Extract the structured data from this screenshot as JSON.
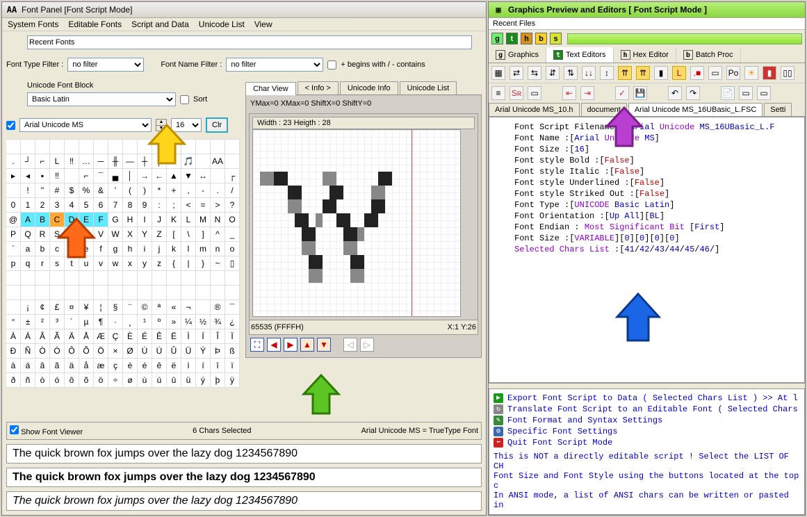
{
  "left": {
    "title": "Font Panel [Font Script Mode]",
    "menu": [
      "System Fonts",
      "Editable Fonts",
      "Script and Data",
      "Unicode List",
      "View"
    ],
    "recent_fonts_label": "Recent Fonts",
    "font_type_filter_label": "Font Type Filter :",
    "font_type_filter_value": "no filter",
    "font_name_filter_label": "Font Name Filter :",
    "font_name_filter_value": "no filter",
    "begins_contains_label": "+ begins with / - contains",
    "unicode_block_label": "Unicode Font Block",
    "unicode_block_value": "Basic Latin",
    "sort_label": "Sort",
    "font_dropdown_value": "Arial Unicode MS",
    "font_size_value": "16",
    "clr_label": "Clr",
    "glyph_rows": [
      [
        "",
        "",
        "",
        "",
        "",
        "",
        "",
        "",
        "",
        "",
        "",
        "",
        "",
        "",
        "",
        ""
      ],
      [
        ".",
        "┘",
        "⌐",
        "L",
        "‼",
        "…",
        "─",
        "╫",
        "—",
        "┼",
        "│",
        "",
        "🎵",
        "",
        "AA",
        ""
      ],
      [
        "▸",
        "◂",
        "▪",
        "‼",
        "",
        "⌐",
        "¯",
        "▄",
        "│",
        "→",
        "←",
        "▲",
        "▼",
        "↔",
        "",
        "┌"
      ],
      [
        "",
        "!",
        "\"",
        "#",
        "$",
        "%",
        "&",
        "'",
        "(",
        ")",
        "*",
        "+",
        ",",
        "-",
        ".",
        "/"
      ],
      [
        "0",
        "1",
        "2",
        "3",
        "4",
        "5",
        "6",
        "7",
        "8",
        "9",
        ":",
        ";",
        "<",
        "=",
        ">",
        "?"
      ],
      [
        "@",
        "A",
        "B",
        "C",
        "D",
        "E",
        "F",
        "G",
        "H",
        "I",
        "J",
        "K",
        "L",
        "M",
        "N",
        "O"
      ],
      [
        "P",
        "Q",
        "R",
        "S",
        "T",
        "U",
        "V",
        "W",
        "X",
        "Y",
        "Z",
        "[",
        "\\",
        "]",
        "^",
        "_"
      ],
      [
        "`",
        "a",
        "b",
        "c",
        "d",
        "e",
        "f",
        "g",
        "h",
        "i",
        "j",
        "k",
        "l",
        "m",
        "n",
        "o"
      ],
      [
        "p",
        "q",
        "r",
        "s",
        "t",
        "u",
        "v",
        "w",
        "x",
        "y",
        "z",
        "{",
        "|",
        "}",
        "~",
        "▯"
      ],
      [
        "",
        "",
        "",
        "",
        "",
        "",
        "",
        "",
        "",
        "",
        "",
        "",
        "",
        "",
        "",
        ""
      ],
      [
        "",
        "",
        "",
        "",
        "",
        "",
        "",
        "",
        "",
        "",
        "",
        "",
        "",
        "",
        "",
        ""
      ],
      [
        "",
        "¡",
        "¢",
        "£",
        "¤",
        "¥",
        "¦",
        "§",
        "¨",
        "©",
        "ª",
        "«",
        "¬",
        "",
        "®",
        "¯"
      ],
      [
        "°",
        "±",
        "²",
        "³",
        "´",
        "µ",
        "¶",
        "·",
        "¸",
        "¹",
        "º",
        "»",
        "¼",
        "½",
        "¾",
        "¿"
      ],
      [
        "À",
        "Á",
        "Â",
        "Ã",
        "Ä",
        "Å",
        "Æ",
        "Ç",
        "È",
        "É",
        "Ê",
        "Ë",
        "Ì",
        "Í",
        "Î",
        "Ï"
      ],
      [
        "Ð",
        "Ñ",
        "Ò",
        "Ó",
        "Ô",
        "Õ",
        "Ö",
        "×",
        "Ø",
        "Ù",
        "Ú",
        "Û",
        "Ü",
        "Ý",
        "Þ",
        "ß"
      ],
      [
        "à",
        "á",
        "â",
        "ã",
        "ä",
        "å",
        "æ",
        "ç",
        "è",
        "é",
        "ê",
        "ë",
        "ì",
        "í",
        "î",
        "ï"
      ],
      [
        "ð",
        "ñ",
        "ò",
        "ó",
        "ô",
        "õ",
        "ö",
        "÷",
        "ø",
        "ù",
        "ú",
        "û",
        "ü",
        "ý",
        "þ",
        "ÿ"
      ]
    ],
    "selected_glyphs": {
      "row": 5,
      "cols": [
        1,
        2,
        3,
        4,
        5,
        6
      ],
      "orange_col": 3
    },
    "char_view_tabs": [
      "Char View",
      "< Info >",
      "Unicode Info",
      "Unicode List"
    ],
    "char_view_active": 0,
    "ymax_line": "YMax=0  XMax=0  ShiftX=0  ShiftY=0",
    "width_height_line": "Width : 23  Heigth : 28",
    "char_code": "65535  (FFFFH)",
    "char_pos": "X:1 Y:26",
    "show_font_viewer_label": "Show Font Viewer",
    "chars_selected": "6 Chars Selected",
    "truetype_label": "Arial Unicode MS = TrueType Font",
    "sample_text": "The quick brown fox jumps over the lazy dog 1234567890"
  },
  "right": {
    "title": "Graphics Preview and Editors [ Font Script Mode ]",
    "recent_files_label": "Recent Files",
    "color_tabs": [
      {
        "letter": "g",
        "bg": "#6df06d"
      },
      {
        "letter": "t",
        "bg": "#1a8a1a",
        "fg": "#fff"
      },
      {
        "letter": "h",
        "bg": "#d4941a"
      },
      {
        "letter": "b",
        "bg": "#ffd022"
      },
      {
        "letter": "s",
        "bg": "#d7e62c"
      }
    ],
    "main_tabs": [
      {
        "icon": "g",
        "label": "Graphics"
      },
      {
        "icon": "t",
        "label": "Text Editors",
        "active": true,
        "bg": "#1a8a1a"
      },
      {
        "icon": "h",
        "label": "Hex Editor"
      },
      {
        "icon": "b",
        "label": "Batch Proc"
      }
    ],
    "file_tabs": [
      {
        "label": "Arial Unicode MS_10.h"
      },
      {
        "label": "document"
      },
      {
        "label": "Arial Unicode MS_16UBasic_L.FSC",
        "active": true
      },
      {
        "label": "Setti"
      }
    ],
    "script_lines": [
      [
        {
          "t": "Font Script Filename :["
        },
        {
          "t": "Arial ",
          "c": "blue"
        },
        {
          "t": "Unicode",
          "c": "purple"
        },
        {
          "t": " MS_16UBasic_L.F",
          "c": "blue"
        }
      ],
      [
        {
          "t": "Font Name :["
        },
        {
          "t": "Arial ",
          "c": "blue"
        },
        {
          "t": "Unicode",
          "c": "purple"
        },
        {
          "t": " MS",
          "c": "blue"
        },
        {
          "t": "]"
        }
      ],
      [
        {
          "t": "Font Size :["
        },
        {
          "t": "16",
          "c": "blue"
        },
        {
          "t": "]"
        }
      ],
      [
        {
          "t": "Font style Bold :["
        },
        {
          "t": "False",
          "c": "red"
        },
        {
          "t": "]"
        }
      ],
      [
        {
          "t": "Font style Italic :["
        },
        {
          "t": "False",
          "c": "red"
        },
        {
          "t": "]"
        }
      ],
      [
        {
          "t": "Font style Underlined :["
        },
        {
          "t": "False",
          "c": "red"
        },
        {
          "t": "]"
        }
      ],
      [
        {
          "t": "Font style Striked Out :["
        },
        {
          "t": "False",
          "c": "red"
        },
        {
          "t": "]"
        }
      ],
      [
        {
          "t": "Font Type :["
        },
        {
          "t": "UNICODE",
          "c": "purple"
        },
        {
          "t": " Basic Latin",
          "c": "blue"
        },
        {
          "t": "]"
        }
      ],
      [
        {
          "t": "Font Orientation :["
        },
        {
          "t": "Up All",
          "c": "blue"
        },
        {
          "t": "]["
        },
        {
          "t": "BL",
          "c": "blue"
        },
        {
          "t": "]"
        }
      ],
      [
        {
          "t": "Font Endian : "
        },
        {
          "t": "Most Significant Bit",
          "c": "purple"
        },
        {
          "t": " ["
        },
        {
          "t": "First",
          "c": "blue"
        },
        {
          "t": "]"
        }
      ],
      [
        {
          "t": "Font Size :["
        },
        {
          "t": "VARIABLE",
          "c": "purple"
        },
        {
          "t": "]["
        },
        {
          "t": "0",
          "c": "blue"
        },
        {
          "t": "]["
        },
        {
          "t": "0",
          "c": "blue"
        },
        {
          "t": "]["
        },
        {
          "t": "0",
          "c": "blue"
        },
        {
          "t": "]["
        },
        {
          "t": "0",
          "c": "blue"
        },
        {
          "t": "]"
        }
      ],
      [
        {
          "t": "Selected Chars List",
          "c": "purple"
        },
        {
          "t": " :["
        },
        {
          "t": "41",
          "c": "blue"
        },
        {
          "t": "/"
        },
        {
          "t": "42",
          "c": "blue"
        },
        {
          "t": "/"
        },
        {
          "t": "43",
          "c": "blue"
        },
        {
          "t": "/"
        },
        {
          "t": "44",
          "c": "blue"
        },
        {
          "t": "/"
        },
        {
          "t": "45",
          "c": "blue"
        },
        {
          "t": "/"
        },
        {
          "t": "46",
          "c": "blue"
        },
        {
          "t": "/]"
        }
      ]
    ],
    "actions": [
      {
        "icon": "▶",
        "bg": "#1a9a1a",
        "text": "Export Font Script to Data  ( Selected Chars List ) >> At l"
      },
      {
        "icon": "↻",
        "bg": "#888",
        "text": "Translate Font Script to an Editable Font ( Selected Chars "
      },
      {
        "icon": "✎",
        "bg": "#3a8a3a",
        "text": "Font Format and Syntax Settings"
      },
      {
        "icon": "⚙",
        "bg": "#3a6aaa",
        "text": "Specific Font Settings"
      },
      {
        "icon": "⬅",
        "bg": "#cc2222",
        "text": "Quit Font Script Mode"
      }
    ],
    "note_lines": [
      " This is NOT a directly editable script ! Select the LIST OF CH",
      " Font Size and Font Style using the buttons located at the top c",
      " In ANSI mode, a list of ANSI chars can be written or pasted in"
    ]
  }
}
